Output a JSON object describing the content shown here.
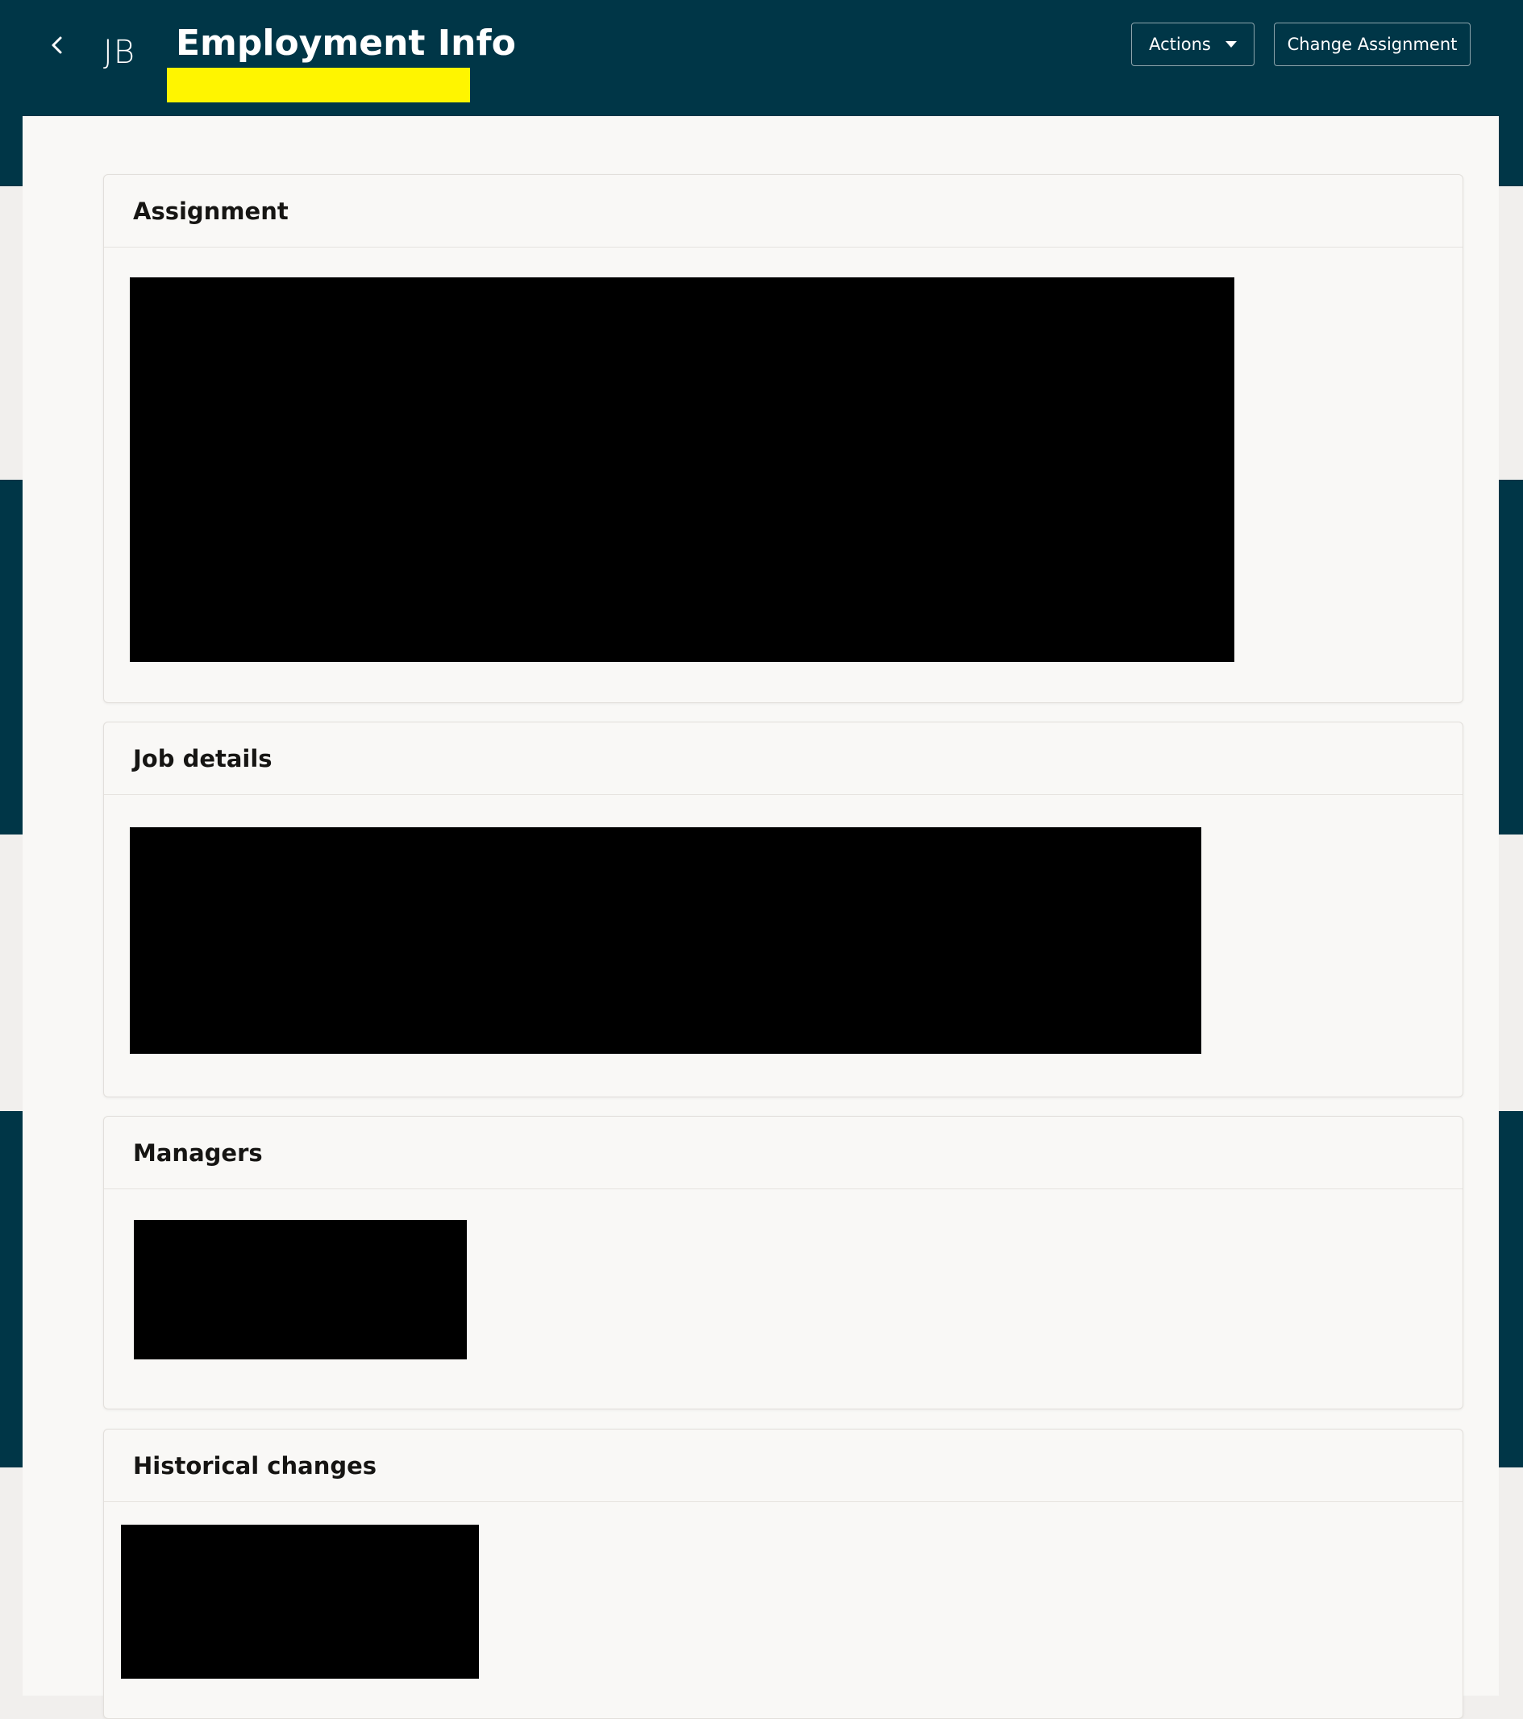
{
  "header": {
    "avatar_initials": "JB",
    "title": "Employment Info",
    "actions_label": "Actions",
    "change_assignment_label": "Change Assignment"
  },
  "sections": [
    {
      "title": "Assignment"
    },
    {
      "title": "Job details"
    },
    {
      "title": "Managers"
    },
    {
      "title": "Historical changes"
    }
  ],
  "colors": {
    "header_bg": "#003647",
    "highlight": "#fff500",
    "panel_bg": "#f9f8f6",
    "redaction": "#000000"
  }
}
